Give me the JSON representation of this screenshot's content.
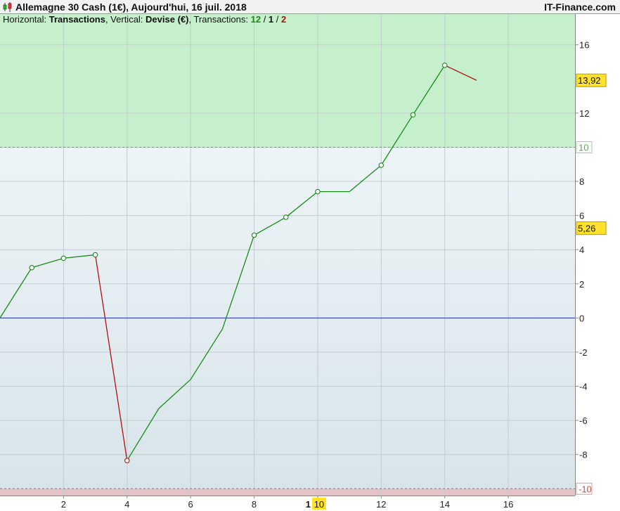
{
  "header": {
    "title": "Allemagne 30 Cash (1€), Aujourd'hui, 16 juil. 2018",
    "brand": "IT-Finance.com"
  },
  "subtitle": {
    "h_prefix": "Horizontal: ",
    "h_value": "Transactions",
    "v_prefix": ", Vertical: ",
    "v_value": "Devise (€)",
    "t_prefix": ", Transactions: ",
    "t_win": "12",
    "sep1": " / ",
    "t_even": "1",
    "sep2": " / ",
    "t_loss": "2"
  },
  "colors": {
    "win": "#1a8a1a",
    "loss": "#b01010",
    "zero_line": "#2233bb",
    "upper_zone": "#c6f0cc",
    "lower_zone": "#e4c3c6",
    "marker_fill": "#ffffff",
    "badge_yellow": "#ffe32b"
  },
  "chart_data": {
    "type": "line",
    "xlabel": "Transactions",
    "ylabel": "Devise (€)",
    "x_ticks": [
      "2",
      "4",
      "6",
      "8",
      "10",
      "12",
      "14",
      "16"
    ],
    "x_tick_values": [
      2,
      4,
      6,
      8,
      10,
      12,
      14,
      16
    ],
    "x_highlight": {
      "value": 10,
      "label": "10",
      "prefix": "1"
    },
    "y_ticks": [
      "-8",
      "-6",
      "-4",
      "-2",
      "0",
      "2",
      "4",
      "6",
      "8",
      "12",
      "16"
    ],
    "y_tick_values": [
      -8,
      -6,
      -4,
      -2,
      0,
      2,
      4,
      6,
      8,
      12,
      16
    ],
    "xlim": [
      0,
      18.1
    ],
    "ylim": [
      -10.4,
      17.8
    ],
    "grid": true,
    "series": [
      {
        "x": [
          0,
          1,
          2,
          3,
          4,
          5,
          6,
          7,
          8,
          9,
          10,
          11,
          12,
          13,
          14,
          15
        ],
        "y": [
          0,
          2.95,
          3.5,
          3.7,
          -8.35,
          -5.3,
          -3.6,
          -0.65,
          4.85,
          5.9,
          7.4,
          7.4,
          8.95,
          11.9,
          14.8,
          13.92
        ],
        "markers": [
          1,
          2,
          3,
          4,
          8,
          9,
          10,
          12,
          13,
          14
        ]
      }
    ],
    "thresholds": {
      "upper": {
        "value": 10,
        "label": "10"
      },
      "lower": {
        "value": -10,
        "label": "-10"
      }
    },
    "price_badges": [
      {
        "value": 13.92,
        "label": "13,92"
      },
      {
        "value": 5.26,
        "label": "5,26"
      }
    ]
  }
}
